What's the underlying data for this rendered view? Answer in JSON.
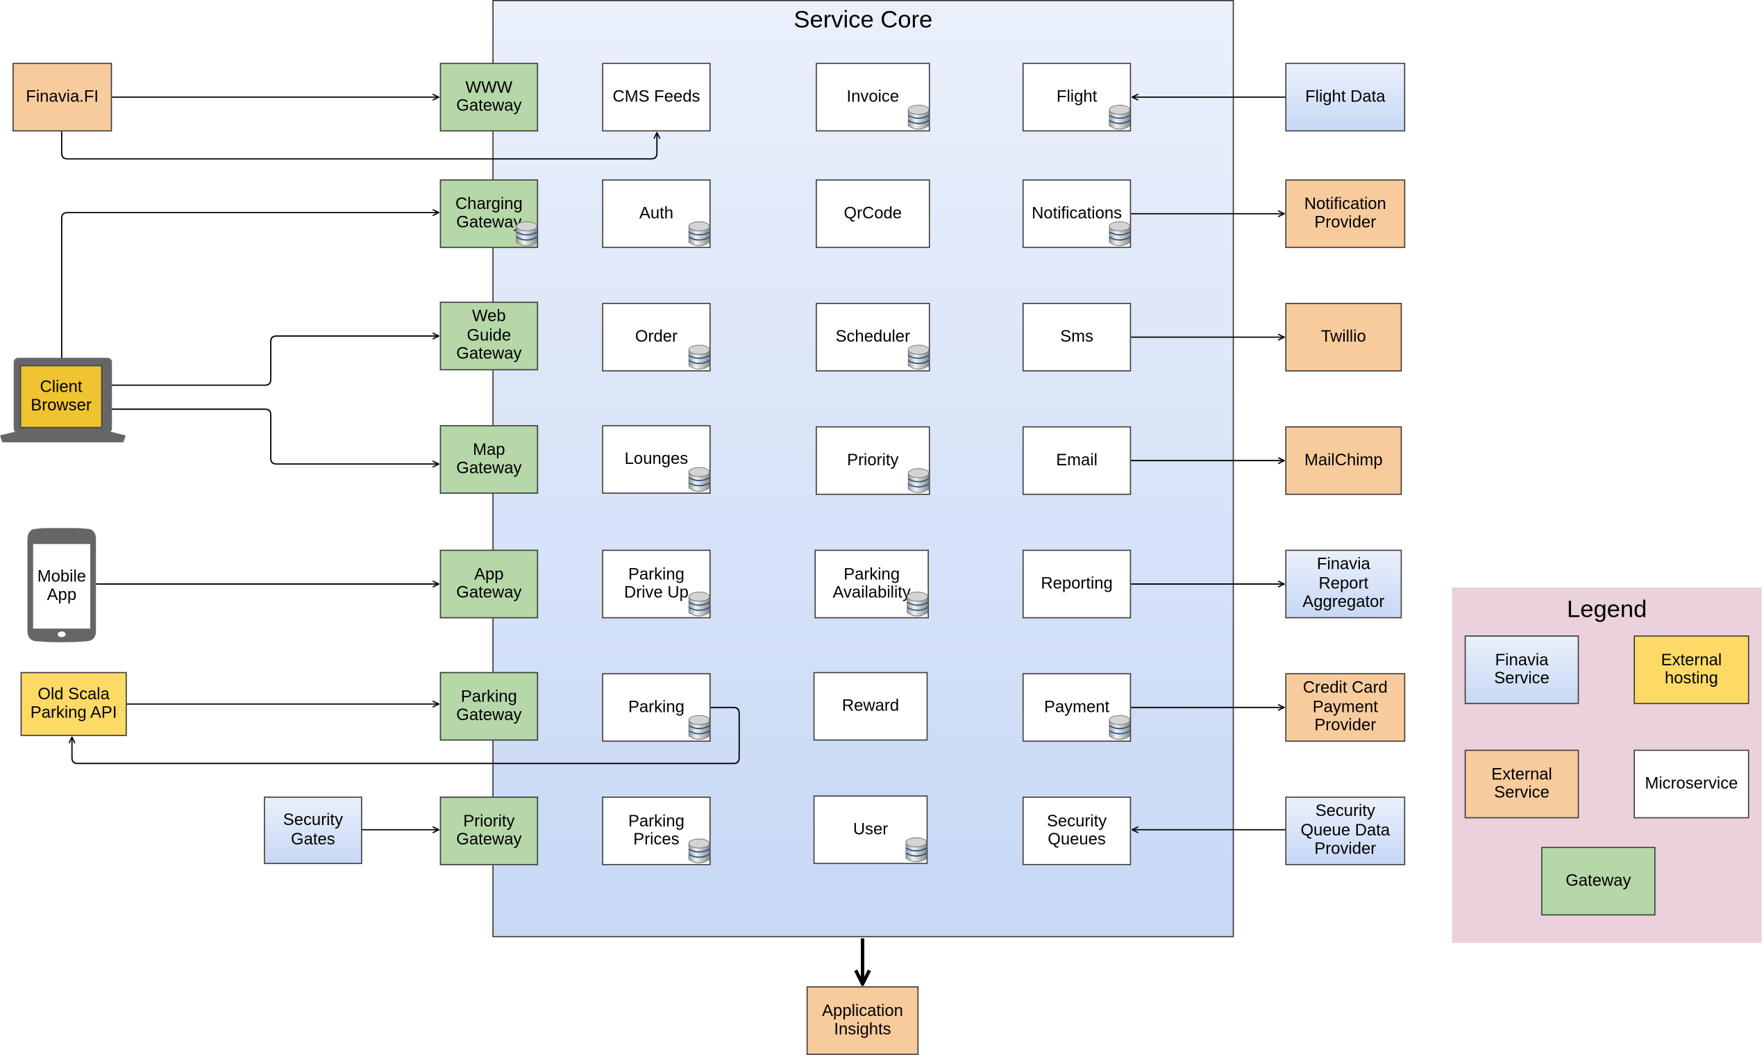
{
  "title": "Service Core",
  "colors": {
    "gateway": "#b6d7a8",
    "external_service": "#f8cb9d",
    "external_hosting": "#fdd966",
    "finavia_service_top": "#eaf0fb",
    "finavia_service_bottom": "#c7d8f5",
    "microservice": "#ffffff",
    "legend_bg": "#ead1dc",
    "client_browser": "#f0c330",
    "device": "#666666"
  },
  "clients": {
    "finavia_fi": "Finavia.FI",
    "client_browser": "Client\nBrowser",
    "mobile_app": "Mobile\nApp",
    "old_scala": "Old Scala\nParking API",
    "security_gates": "Security\nGates"
  },
  "gateways": [
    "WWW\nGateway",
    "Charging\nGateway",
    "Web\nGuide\nGateway",
    "Map\nGateway",
    "App\nGateway",
    "Parking\nGateway",
    "Priority\nGateway"
  ],
  "services_col1": [
    "CMS Feeds",
    "Auth",
    "Order",
    "Lounges",
    "Parking\nDrive Up",
    "Parking",
    "Parking\nPrices"
  ],
  "services_col2": [
    "Invoice",
    "QrCode",
    "Scheduler",
    "Priority",
    "Parking\nAvailability",
    "Reward",
    "User"
  ],
  "services_col3": [
    "Flight",
    "Notifications",
    "Sms",
    "Email",
    "Reporting",
    "Payment",
    "Security\nQueues"
  ],
  "providers": [
    "Flight Data",
    "Notification\nProvider",
    "Twillio",
    "MailChimp",
    "Finavia\nReport\nAggregator",
    "Credit Card\nPayment\nProvider",
    "Security\nQueue Data\nProvider"
  ],
  "application_insights": "Application\nInsights",
  "legend": {
    "title": "Legend",
    "items": [
      "Finavia\nService",
      "External\nhosting",
      "External\nService",
      "Microservice",
      "Gateway"
    ]
  },
  "database_icons_on": [
    "Charging Gateway",
    "Auth",
    "Order",
    "Lounges",
    "Parking Drive Up",
    "Parking",
    "Parking Prices",
    "Invoice",
    "Scheduler",
    "Priority",
    "Parking Availability",
    "User",
    "Flight",
    "Notifications",
    "Payment"
  ]
}
